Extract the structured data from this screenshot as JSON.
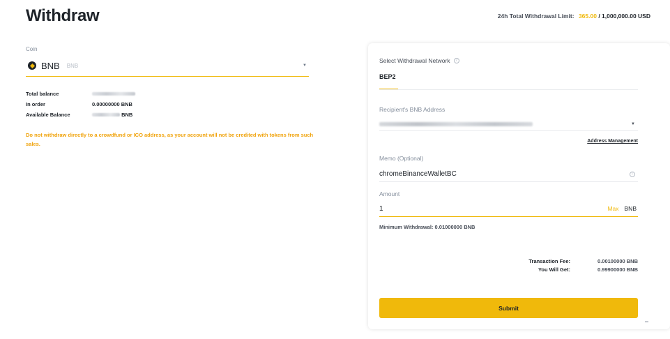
{
  "page": {
    "title": "Withdraw"
  },
  "limit": {
    "label": "24h Total Withdrawal Limit:",
    "used": "365.00",
    "total": "/ 1,000,000.00 USD"
  },
  "coin": {
    "label": "Coin",
    "symbol": "BNB",
    "name": "BNB",
    "icon": "bnb-logo-icon"
  },
  "balances": [
    {
      "label": "Total balance",
      "value": ""
    },
    {
      "label": "In order",
      "value": "0.00000000 BNB"
    },
    {
      "label": "Available Balance",
      "value": "BNB"
    }
  ],
  "warning": "Do not withdraw directly to a crowdfund or ICO address, as your account will not be credited with tokens from such sales.",
  "form": {
    "network_label": "Select Withdrawal Network",
    "network_tab": "BEP2",
    "address_label": "Recipient's BNB Address",
    "address_management": "Address Management",
    "memo_label": "Memo (Optional)",
    "memo_value": "chromeBinanceWalletBC",
    "amount_label": "Amount",
    "amount_value": "1",
    "max_label": "Max",
    "amount_unit": "BNB",
    "min_withdrawal": "Minimum Withdrawal: 0.01000000 BNB",
    "fee_label": "Transaction Fee:",
    "fee_value": "0.00100000 BNB",
    "receive_label": "You Will Get:",
    "receive_value": "0.99900000 BNB",
    "submit_label": "Submit"
  },
  "colors": {
    "accent": "#f0b90b",
    "text": "#1e2329",
    "muted": "#848e9c",
    "warning": "#f0a30b"
  }
}
